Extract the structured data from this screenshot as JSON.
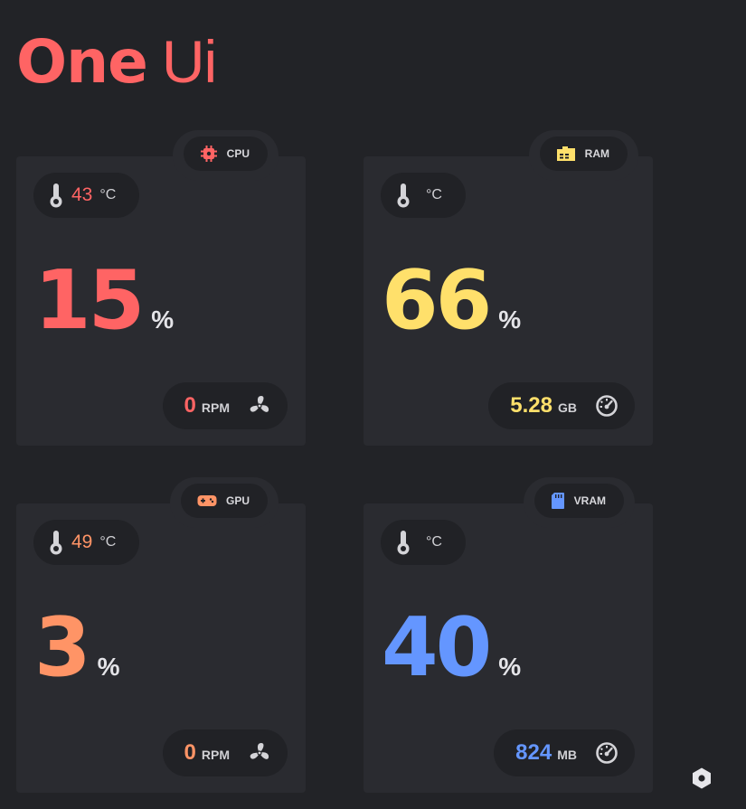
{
  "app": {
    "title_bold": "One",
    "title_light": "Ui"
  },
  "colors": {
    "background": "#222327",
    "card": "#2a2b30",
    "pill": "#212226",
    "cpu": "#ff6464",
    "ram": "#ffe06b",
    "gpu": "#ff9466",
    "vram": "#6496ff",
    "title": "#ff6464"
  },
  "cards": {
    "cpu": {
      "label": "CPU",
      "icon": "cpu-chip-icon",
      "temperature": "43",
      "temperature_unit": "°C",
      "usage": "15",
      "usage_unit": "%",
      "secondary_value": "0",
      "secondary_unit": "RPM",
      "secondary_icon": "fan-icon"
    },
    "ram": {
      "label": "RAM",
      "icon": "memory-icon",
      "temperature": "",
      "temperature_unit": "°C",
      "usage": "66",
      "usage_unit": "%",
      "secondary_value": "5.28",
      "secondary_unit": "GB",
      "secondary_icon": "gauge-icon"
    },
    "gpu": {
      "label": "GPU",
      "icon": "gamepad-icon",
      "temperature": "49",
      "temperature_unit": "°C",
      "usage": "3",
      "usage_unit": "%",
      "secondary_value": "0",
      "secondary_unit": "RPM",
      "secondary_icon": "fan-icon"
    },
    "vram": {
      "label": "VRAM",
      "icon": "sd-card-icon",
      "temperature": "",
      "temperature_unit": "°C",
      "usage": "40",
      "usage_unit": "%",
      "secondary_value": "824",
      "secondary_unit": "MB",
      "secondary_icon": "gauge-icon"
    }
  },
  "footer": {
    "settings_icon": "hexagon-settings-icon"
  }
}
